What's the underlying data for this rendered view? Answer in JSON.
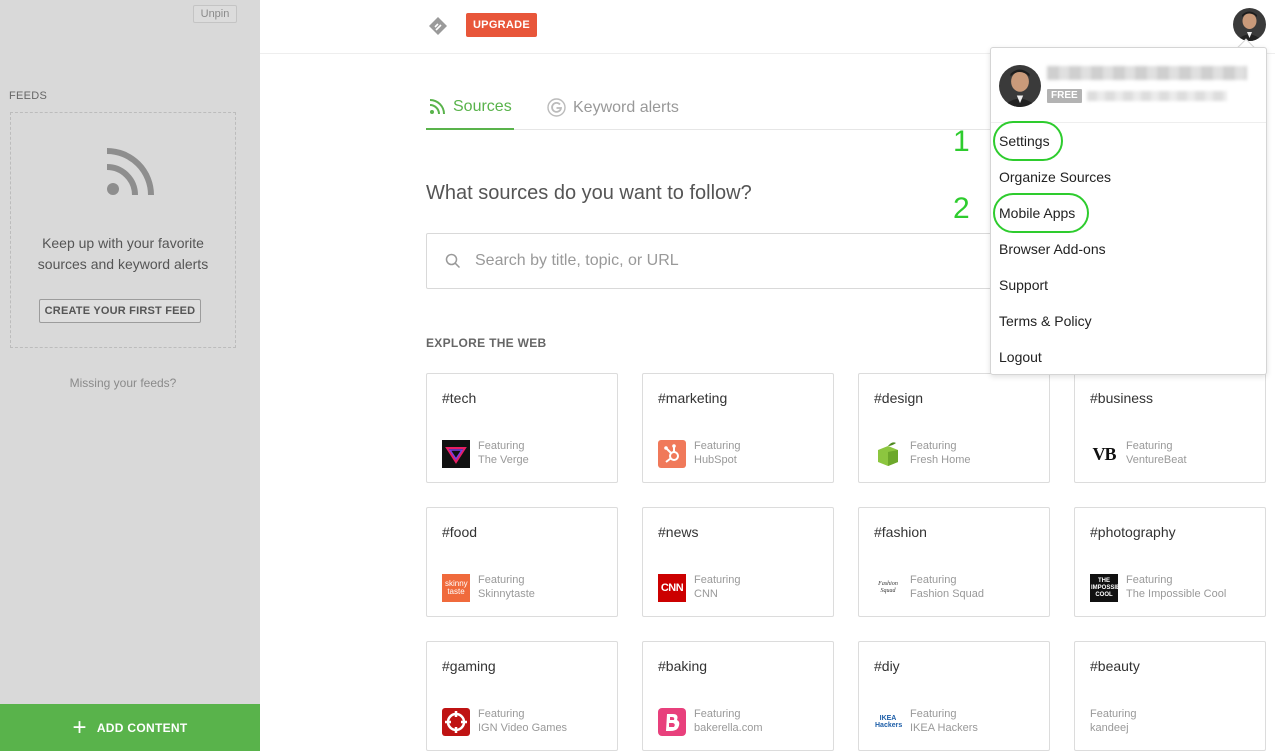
{
  "sidebar": {
    "unpin": "Unpin",
    "feeds_label": "FEEDS",
    "empty_line1": "Keep up with your favorite",
    "empty_line2": "sources and keyword alerts",
    "create_button": "CREATE YOUR FIRST FEED",
    "missing_link": "Missing your feeds?",
    "add_content": "ADD CONTENT"
  },
  "header": {
    "upgrade": "UPGRADE"
  },
  "tabs": [
    {
      "label": "Sources",
      "icon": "rss-icon",
      "active": true
    },
    {
      "label": "Keyword alerts",
      "icon": "google-icon",
      "active": false
    }
  ],
  "main": {
    "question": "What sources do you want to follow?",
    "search_placeholder": "Search by title, topic, or URL",
    "explore_heading": "EXPLORE THE WEB"
  },
  "cards": [
    {
      "tag": "#tech",
      "featuring": "Featuring",
      "source": "The Verge",
      "icon": "verge-icon"
    },
    {
      "tag": "#marketing",
      "featuring": "Featuring",
      "source": "HubSpot",
      "icon": "hubspot-icon"
    },
    {
      "tag": "#design",
      "featuring": "Featuring",
      "source": "Fresh Home",
      "icon": "freshhome-icon"
    },
    {
      "tag": "#business",
      "featuring": "Featuring",
      "source": "VentureBeat",
      "icon": "venturebeat-icon"
    },
    {
      "tag": "#food",
      "featuring": "Featuring",
      "source": "Skinnytaste",
      "icon": "skinnytaste-icon"
    },
    {
      "tag": "#news",
      "featuring": "Featuring",
      "source": "CNN",
      "icon": "cnn-icon"
    },
    {
      "tag": "#fashion",
      "featuring": "Featuring",
      "source": "Fashion Squad",
      "icon": "fashionsquad-icon"
    },
    {
      "tag": "#photography",
      "featuring": "Featuring",
      "source": "The Impossible Cool",
      "icon": "impossiblecool-icon"
    },
    {
      "tag": "#gaming",
      "featuring": "Featuring",
      "source": "IGN Video Games",
      "icon": "ign-icon"
    },
    {
      "tag": "#baking",
      "featuring": "Featuring",
      "source": "bakerella.com",
      "icon": "bakerella-icon"
    },
    {
      "tag": "#diy",
      "featuring": "Featuring",
      "source": "IKEA Hackers",
      "icon": "ikeahackers-icon"
    },
    {
      "tag": "#beauty",
      "featuring": "Featuring",
      "source": "kandeej",
      "icon": ""
    }
  ],
  "icon_text": {
    "skinnytaste": "skinny taste",
    "cnn": "CNN",
    "vb": "VB",
    "impossible_cool": "THE IMPOSSIBLE COOL",
    "ikea_hackers": "IKEA Hackers",
    "fashion_squad": "Fashion Squad"
  },
  "user_menu": {
    "plan_badge": "FREE",
    "items": [
      "Settings",
      "Organize Sources",
      "Mobile Apps",
      "Browser Add-ons",
      "Support",
      "Terms & Policy",
      "Logout"
    ]
  },
  "annotations": {
    "one": "1",
    "two": "2"
  },
  "colors": {
    "accent_green": "#59b34b",
    "upgrade_red": "#e8563a",
    "annotation_green": "#2ecc2e"
  }
}
